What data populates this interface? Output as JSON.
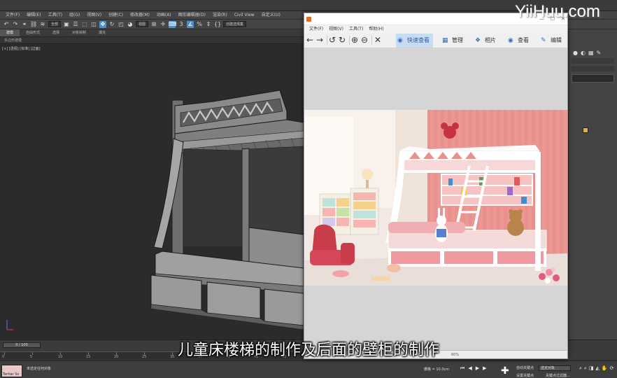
{
  "max": {
    "title": "",
    "menu": [
      "文件(F)",
      "编辑(E)",
      "工具(T)",
      "组(G)",
      "视图(V)",
      "创建(C)",
      "修改器(M)",
      "动画(A)",
      "图形编辑器(D)",
      "渲染(R)",
      "Civil View",
      "自定义(U)"
    ],
    "toolbar": {
      "filter": "全部",
      "view": "视图",
      "selection_set": "创建选择集"
    },
    "ribbon_tabs": [
      "建模",
      "自由形式",
      "选择",
      "对象绘制",
      "填充"
    ],
    "ribbon_active": "建模",
    "subribbon": "多边形建模",
    "viewport_label": "[+] [透视] [标准] [边面]"
  },
  "timeline": {
    "frame_slider": "0 / 100",
    "tick_labels": [
      "0",
      "5",
      "10",
      "15",
      "20",
      "25",
      "30",
      "35",
      "40",
      "45",
      "50",
      "55",
      "60",
      "65",
      "70",
      "75",
      "80",
      "85",
      "90",
      "95",
      "100"
    ]
  },
  "status": {
    "swatch_label": "Tertiar Sc",
    "line1": "未选定任何对象",
    "line2": "",
    "grid": "栅格 = 10.0cm",
    "auto_key": "自动关键点",
    "set_key": "设置关键点",
    "selection_dropdown": "选定对象",
    "key_filter": "关键点过滤器..."
  },
  "acdsee": {
    "title": "",
    "menu": [
      "文件(F)",
      "视图(V)",
      "工具(T)",
      "帮助(H)"
    ],
    "tabs": [
      {
        "label": "快速查看",
        "icon": "eye-icon",
        "active": true
      },
      {
        "label": "管理",
        "icon": "grid-icon",
        "active": false
      },
      {
        "label": "相片",
        "icon": "photo-icon",
        "active": false
      },
      {
        "label": "查看",
        "icon": "eye-icon",
        "active": false
      },
      {
        "label": "编辑",
        "icon": "edit-icon",
        "active": false
      }
    ],
    "status": "60%"
  },
  "subtitle": "儿童床楼梯的制作及后面的壁柜的制作",
  "watermark": "YiiHuu.com",
  "colors": {
    "accent": "#4a8fd4",
    "acd_active_tab": "#c7dcf0",
    "wall_pink": "#e8918d"
  }
}
